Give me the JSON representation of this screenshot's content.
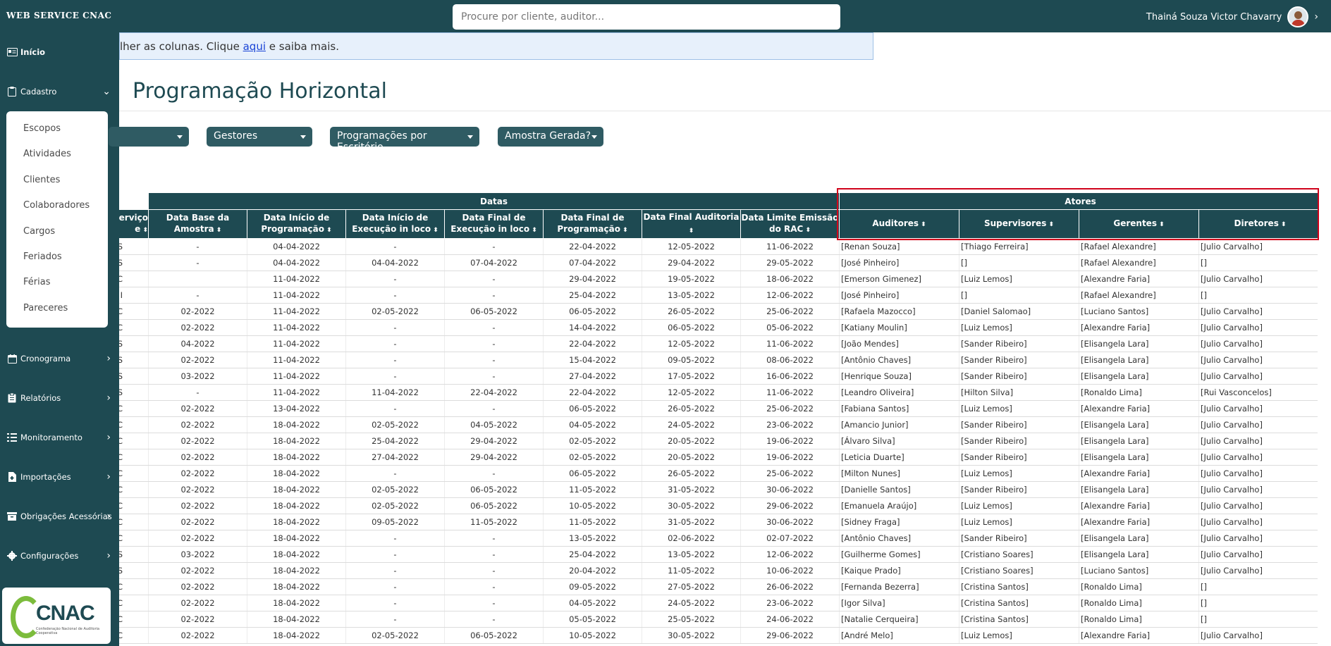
{
  "app": {
    "brand": "WEB SERVICE CNAC"
  },
  "search": {
    "placeholder": "Procure por cliente, auditor..."
  },
  "user": {
    "name": "Thainá Souza Victor Chavarry",
    "chevron": "›"
  },
  "sidebar": {
    "inicio": "Início",
    "cadastro": "Cadastro",
    "cadastro_items": [
      "Escopos",
      "Atividades",
      "Clientes",
      "Colaboradores",
      "Cargos",
      "Feriados",
      "Férias",
      "Pareceres"
    ],
    "cronograma": "Cronograma",
    "relatorios": "Relatórios",
    "monitoramento": "Monitoramento",
    "importacoes": "Importações",
    "obrigacoes": "Obrigações Acessórias",
    "configuracoes": "Configurações",
    "logo_text": "CNAC",
    "logo_sub": "Confederação Nacional de Auditoria Cooperativa"
  },
  "info": {
    "before": "lher as colunas. Clique ",
    "link": "aqui",
    "after": " e saiba mais."
  },
  "page": {
    "title": "Programação Horizontal"
  },
  "filters": [
    "Gestores",
    "Programações por Escritório",
    "Amostra Gerada?"
  ],
  "table": {
    "groups": {
      "datas": "Datas",
      "atores": "Atores"
    },
    "columns": [
      "erviço\ne",
      "Data Base da Amostra",
      "Data Início de Programação",
      "Data Início de Execução in loco",
      "Data Final de Execução in loco",
      "Data Final de Programação",
      "Data Final Auditoria",
      "Data Limite Emissão do RAC",
      "Auditores",
      "Supervisores",
      "Gerentes",
      "Diretores"
    ],
    "sort_icon": "⬍",
    "rows": [
      [
        "S",
        "-",
        "04-04-2022",
        "-",
        "-",
        "22-04-2022",
        "12-05-2022",
        "11-06-2022",
        "[Renan Souza]",
        "[Thiago Ferreira]",
        "[Rafael Alexandre]",
        "[Julio Carvalho]"
      ],
      [
        "S",
        "-",
        "04-04-2022",
        "04-04-2022",
        "07-04-2022",
        "07-04-2022",
        "29-04-2022",
        "29-05-2022",
        "[José Pinheiro]",
        "[]",
        "[Rafael Alexandre]",
        "[]"
      ],
      [
        "C",
        "",
        "11-04-2022",
        "-",
        "-",
        "29-04-2022",
        "19-05-2022",
        "18-06-2022",
        "[Emerson Gimenez]",
        "[Luiz Lemos]",
        "[Alexandre Faria]",
        "[Julio Carvalho]"
      ],
      [
        "I",
        "-",
        "11-04-2022",
        "-",
        "-",
        "25-04-2022",
        "13-05-2022",
        "12-06-2022",
        "[José Pinheiro]",
        "[]",
        "[Rafael Alexandre]",
        "[]"
      ],
      [
        "C",
        "02-2022",
        "11-04-2022",
        "02-05-2022",
        "06-05-2022",
        "06-05-2022",
        "26-05-2022",
        "25-06-2022",
        "[Rafaela Mazocco]",
        "[Daniel Salomao]",
        "[Luciano Santos]",
        "[Julio Carvalho]"
      ],
      [
        "C",
        "02-2022",
        "11-04-2022",
        "-",
        "-",
        "14-04-2022",
        "06-05-2022",
        "05-06-2022",
        "[Katiany Moulin]",
        "[Luiz Lemos]",
        "[Alexandre Faria]",
        "[Julio Carvalho]"
      ],
      [
        "S",
        "04-2022",
        "11-04-2022",
        "-",
        "-",
        "22-04-2022",
        "12-05-2022",
        "11-06-2022",
        "[João Mendes]",
        "[Sander Ribeiro]",
        "[Elisangela Lara]",
        "[Julio Carvalho]"
      ],
      [
        "S",
        "02-2022",
        "11-04-2022",
        "-",
        "-",
        "15-04-2022",
        "09-05-2022",
        "08-06-2022",
        "[Antônio Chaves]",
        "[Sander Ribeiro]",
        "[Elisangela Lara]",
        "[Julio Carvalho]"
      ],
      [
        "S",
        "03-2022",
        "11-04-2022",
        "-",
        "-",
        "27-04-2022",
        "17-05-2022",
        "16-06-2022",
        "[Henrique Souza]",
        "[Sander Ribeiro]",
        "[Elisangela Lara]",
        "[Julio Carvalho]"
      ],
      [
        "S",
        "-",
        "11-04-2022",
        "11-04-2022",
        "22-04-2022",
        "22-04-2022",
        "12-05-2022",
        "11-06-2022",
        "[Leandro Oliveira]",
        "[Hilton Silva]",
        "[Ronaldo Lima]",
        "[Rui Vasconcelos]"
      ],
      [
        "C",
        "02-2022",
        "13-04-2022",
        "-",
        "-",
        "06-05-2022",
        "26-05-2022",
        "25-06-2022",
        "[Fabiana Santos]",
        "[Luiz Lemos]",
        "[Alexandre Faria]",
        "[Julio Carvalho]"
      ],
      [
        "C",
        "02-2022",
        "18-04-2022",
        "02-05-2022",
        "04-05-2022",
        "04-05-2022",
        "24-05-2022",
        "23-06-2022",
        "[Amancio Junior]",
        "[Sander Ribeiro]",
        "[Elisangela Lara]",
        "[Julio Carvalho]"
      ],
      [
        "C",
        "02-2022",
        "18-04-2022",
        "25-04-2022",
        "29-04-2022",
        "02-05-2022",
        "20-05-2022",
        "19-06-2022",
        "[Álvaro Silva]",
        "[Sander Ribeiro]",
        "[Elisangela Lara]",
        "[Julio Carvalho]"
      ],
      [
        "C",
        "02-2022",
        "18-04-2022",
        "27-04-2022",
        "29-04-2022",
        "02-05-2022",
        "20-05-2022",
        "19-06-2022",
        "[Leticia Duarte]",
        "[Sander Ribeiro]",
        "[Elisangela Lara]",
        "[Julio Carvalho]"
      ],
      [
        "C",
        "02-2022",
        "18-04-2022",
        "-",
        "-",
        "06-05-2022",
        "26-05-2022",
        "25-06-2022",
        "[Milton Nunes]",
        "[Luiz Lemos]",
        "[Alexandre Faria]",
        "[Julio Carvalho]"
      ],
      [
        "C",
        "02-2022",
        "18-04-2022",
        "02-05-2022",
        "06-05-2022",
        "11-05-2022",
        "31-05-2022",
        "30-06-2022",
        "[Danielle Santos]",
        "[Sander Ribeiro]",
        "[Elisangela Lara]",
        "[Julio Carvalho]"
      ],
      [
        "C",
        "02-2022",
        "18-04-2022",
        "02-05-2022",
        "06-05-2022",
        "10-05-2022",
        "30-05-2022",
        "29-06-2022",
        "[Emanuela Araújo]",
        "[Luiz Lemos]",
        "[Alexandre Faria]",
        "[Julio Carvalho]"
      ],
      [
        "C",
        "02-2022",
        "18-04-2022",
        "09-05-2022",
        "11-05-2022",
        "11-05-2022",
        "31-05-2022",
        "30-06-2022",
        "[Sidney Fraga]",
        "[Luiz Lemos]",
        "[Alexandre Faria]",
        "[Julio Carvalho]"
      ],
      [
        "C",
        "02-2022",
        "18-04-2022",
        "-",
        "-",
        "13-05-2022",
        "02-06-2022",
        "02-07-2022",
        "[Antônio Chaves]",
        "[Sander Ribeiro]",
        "[Elisangela Lara]",
        "[Julio Carvalho]"
      ],
      [
        "S",
        "03-2022",
        "18-04-2022",
        "-",
        "-",
        "25-04-2022",
        "13-05-2022",
        "12-06-2022",
        "[Guilherme Gomes]",
        "[Cristiano Soares]",
        "[Elisangela Lara]",
        "[Julio Carvalho]"
      ],
      [
        "S",
        "02-2022",
        "18-04-2022",
        "-",
        "-",
        "20-04-2022",
        "11-05-2022",
        "10-06-2022",
        "[Kaique Prado]",
        "[Cristiano Soares]",
        "[Luciano Santos]",
        "[Julio Carvalho]"
      ],
      [
        "C",
        "02-2022",
        "18-04-2022",
        "-",
        "-",
        "09-05-2022",
        "27-05-2022",
        "26-06-2022",
        "[Fernanda Bezerra]",
        "[Cristina Santos]",
        "[Ronaldo Lima]",
        "[]"
      ],
      [
        "C",
        "02-2022",
        "18-04-2022",
        "-",
        "-",
        "04-05-2022",
        "24-05-2022",
        "23-06-2022",
        "[Igor Silva]",
        "[Cristina Santos]",
        "[Ronaldo Lima]",
        "[]"
      ],
      [
        "C",
        "02-2022",
        "18-04-2022",
        "-",
        "-",
        "05-05-2022",
        "25-05-2022",
        "24-06-2022",
        "[Natalie Cerqueira]",
        "[Cristina Santos]",
        "[Ronaldo Lima]",
        "[]"
      ],
      [
        "C",
        "02-2022",
        "18-04-2022",
        "02-05-2022",
        "06-05-2022",
        "10-05-2022",
        "30-05-2022",
        "29-06-2022",
        "[André Melo]",
        "[Luiz Lemos]",
        "[Alexandre Faria]",
        "[Julio Carvalho]"
      ]
    ]
  },
  "colors": {
    "primary": "#1e4a52",
    "filter_bg": "#2f5b63",
    "highlight": "#d0021b",
    "accent_logo": "#7cbc3c"
  }
}
